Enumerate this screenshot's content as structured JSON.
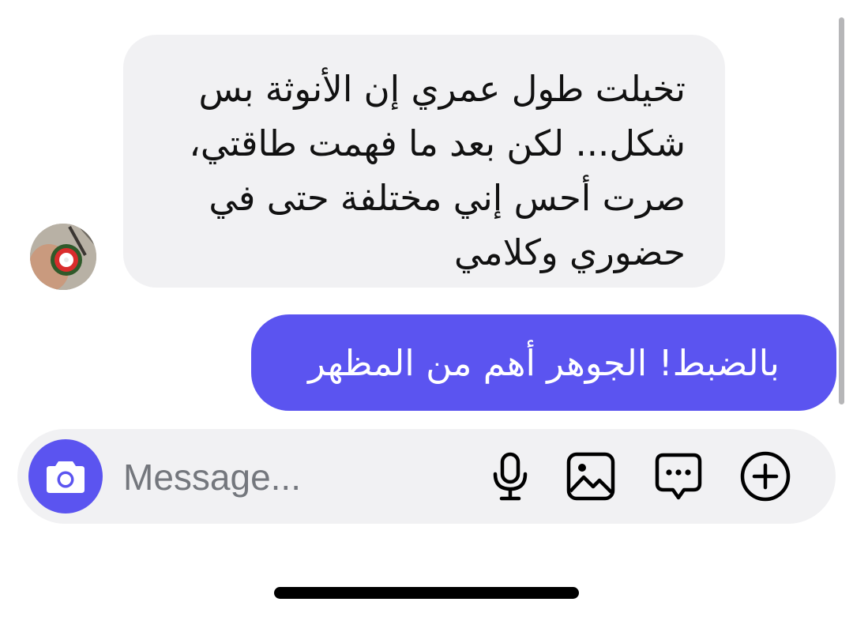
{
  "conversation": {
    "incoming": {
      "lines": [
        "تخيلت طول عمري إن الأنوثة بس",
        "شكل... لكن بعد ما فهمت طاقتي،",
        "صرت أحس إني مختلفة حتى في",
        "حضوري وكلامي"
      ],
      "avatar_icon": "avatar-photo"
    },
    "outgoing": {
      "text": "بالضبط! الجوهر أهم من المظهر"
    }
  },
  "composer": {
    "placeholder": "Message...",
    "value": "",
    "icons": [
      "camera-icon",
      "microphone-icon",
      "image-icon",
      "chat-bubble-icon",
      "plus-circle-icon"
    ]
  },
  "colors": {
    "accent": "#5b54f0",
    "incoming_bubble": "#f1f1f3",
    "composer_bg": "#f1f1f3",
    "placeholder": "#74777d"
  }
}
